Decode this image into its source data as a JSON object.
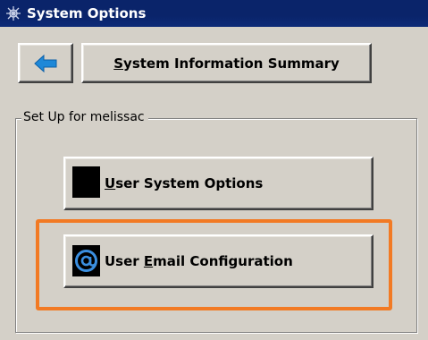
{
  "window": {
    "title": "System Options"
  },
  "toolbar": {
    "back_icon": "back-arrow-icon",
    "sysinfo_label_pre": "",
    "sysinfo_label_ul": "S",
    "sysinfo_label_post": "ystem Information Summary"
  },
  "group": {
    "label": "Set Up for melissac"
  },
  "buttons": [
    {
      "icon": "black-square-icon",
      "label_ul": "U",
      "label_post": "ser System Options"
    },
    {
      "icon": "at-sign-email-icon",
      "label_pre": "User ",
      "label_ul": "E",
      "label_post": "mail Configuration"
    }
  ],
  "colors": {
    "titlebar": "#0a246a",
    "background": "#d4d0c8",
    "highlight": "#f27a24",
    "back_arrow": "#1e88d8",
    "email_icon": "#3b8fe0"
  }
}
